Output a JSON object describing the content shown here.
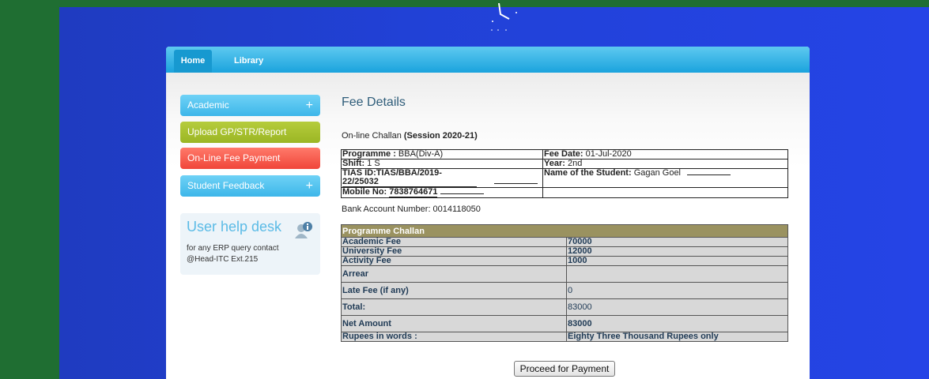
{
  "nav": {
    "home": "Home",
    "library": "Library"
  },
  "sidebar": {
    "items": [
      {
        "label": "Academic",
        "expand": "+"
      },
      {
        "label": "Upload GP/STR/Report"
      },
      {
        "label": "On-Line Fee Payment"
      },
      {
        "label": "Student Feedback",
        "expand": "+"
      }
    ]
  },
  "helpdesk": {
    "title": "User help desk",
    "line1": "for any ERP query contact",
    "line2": "@Head-ITC Ext.215"
  },
  "main": {
    "title": "Fee Details",
    "challan_prefix": "On-line Challan",
    "session": "(Session 2020-21)",
    "info": {
      "programme_label": "Programme :",
      "programme_value": "BBA(Div-A)",
      "fee_date_label": "Fee Date:",
      "fee_date_value": "01-Jul-2020",
      "shift_label": "Shift:",
      "shift_value": "1 S",
      "year_label": "Year:",
      "year_value": "2nd",
      "tias_id": "TIAS ID:TIAS/BBA/2019-22/25032",
      "student_label": "Name of the Student:",
      "student_value": "Gagan Goel",
      "mobile_label": "Mobile No:",
      "mobile_value": "7838764671"
    },
    "bank_account": "Bank Account Number: 0014118050",
    "challan_table": {
      "header": "Programme Challan",
      "rows": [
        {
          "label": "Academic Fee",
          "value": "70000"
        },
        {
          "label": "University Fee",
          "value": "12000"
        },
        {
          "label": "Activity Fee",
          "value": "1000"
        },
        {
          "label": "Arrear",
          "value": ""
        },
        {
          "label": "Late Fee (if any)",
          "value": "0"
        },
        {
          "label": "Total:",
          "value": "83000"
        },
        {
          "label": "Net Amount",
          "value": "83000"
        },
        {
          "label": "Rupees in words :",
          "value": "Eighty Three Thousand Rupees only"
        }
      ]
    },
    "proceed_button": "Proceed for Payment"
  },
  "colors": {
    "navbar": "#1aa3dd",
    "academic": "#3db6e9",
    "upload": "#9bb624",
    "fee_payment": "#f0453a",
    "table_header": "#9a9260"
  }
}
